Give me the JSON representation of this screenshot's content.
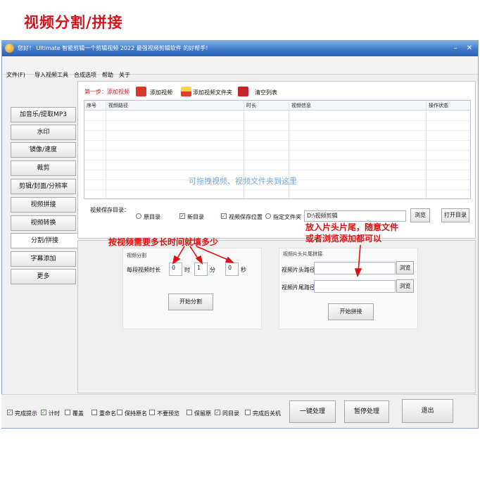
{
  "page_title": "视频分割/拼接",
  "window": {
    "title": "您好！ Ultimate 智能剪辑一个剪辑视频 2022 最强视频剪辑软件 的好帮手!",
    "minimize_glyph": "–",
    "close_glyph": "✕"
  },
  "menu": [
    "文件(F)",
    "导入视频工具",
    "合成选项",
    "帮助",
    "关于"
  ],
  "sidebar": [
    "加音乐/提取MP3",
    "水印",
    "镜像/速度",
    "裁剪",
    "剪辑/封面/分辨率",
    "视频拼接",
    "视频转换",
    "分割/拼接",
    "字幕添加",
    "更多"
  ],
  "sidebar_active_index": 7,
  "toolbar": {
    "step_label": "第一步：添加视频",
    "add_video": "添加视频",
    "add_folder": "添加视频文件夹",
    "clear_list": "清空列表"
  },
  "grid": {
    "columns": [
      "序号",
      "视频路径",
      "时长",
      "视频信息",
      "操作状态"
    ]
  },
  "drop_hint": "可拖拽视频、视频文件夹到这里",
  "options": {
    "output_label": "视频保存目录：",
    "radio_original": "原目录",
    "checkbox_label": "新目录",
    "checkbox2_label": "视频保存位置",
    "radio_custom": "指定文件夹",
    "output_path": "D:\\视频剪辑",
    "browse_btn": "浏览",
    "open_dir_btn": "打开目录"
  },
  "split_group": {
    "title": "视频分割",
    "duration_label": "每段视频时长",
    "hour_value": "0",
    "hour_unit": "时",
    "minute_value": "1",
    "minute_unit": "分",
    "second_value": "0",
    "second_unit": "秒",
    "start_btn": "开始分割"
  },
  "join_group": {
    "title": "视频片头片尾拼接",
    "intro_label": "视频片头路径",
    "outro_label": "视频片尾路径",
    "browse_btn": "浏览",
    "start_btn": "开始拼接"
  },
  "annotations": {
    "left": "按视频需要多长时间就填多少",
    "right_line1": "放入片头片尾，随意文件",
    "right_line2": "或者浏览添加都可以"
  },
  "bottom": {
    "checks": [
      "完成提示",
      "计时",
      "覆盖",
      "重命名",
      "保持原名",
      "不要预览",
      "保留原",
      "同目录",
      "完成后关机"
    ],
    "checked": [
      true,
      true,
      false,
      false,
      false,
      false,
      false,
      true,
      false
    ],
    "btn_one_key": "一键处理",
    "btn_stop": "暂停处理",
    "btn_exit": "退出"
  },
  "colors": {
    "annotation": "#e01010",
    "title_bar": "#3f78c9",
    "drop_hint": "#7aa7d8"
  }
}
